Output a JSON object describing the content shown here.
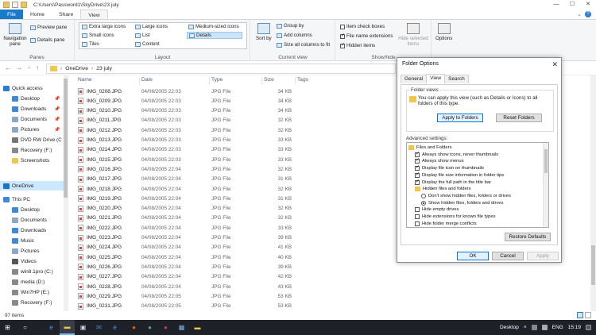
{
  "window": {
    "path": "C:\\Users\\Password1\\SkyDrive\\23 july",
    "controls": [
      "—",
      "☐",
      "✕"
    ]
  },
  "ribbon_tabs": [
    "File",
    "Home",
    "Share",
    "View"
  ],
  "ribbon": {
    "panes": {
      "navigation_pane": "Navigation pane",
      "preview_pane": "Preview pane",
      "details_pane": "Details pane",
      "label": "Panes"
    },
    "layout": {
      "items": [
        "Extra large icons",
        "Large icons",
        "Medium-sized icons",
        "Small icons",
        "List",
        "Details",
        "Tiles",
        "Content"
      ],
      "selected": "Details",
      "label": "Layout"
    },
    "current_view": {
      "sort_by": "Sort by",
      "group_by": "Group by",
      "add_columns": "Add columns",
      "size_all": "Size all columns to fit",
      "label": "Current view"
    },
    "show_hide": {
      "item_check_boxes": {
        "label": "Item check boxes",
        "checked": false
      },
      "file_name_extensions": {
        "label": "File name extensions",
        "checked": true
      },
      "hidden_items": {
        "label": "Hidden items",
        "checked": true
      },
      "hide_selected": "Hide selected items",
      "label": "Show/hide"
    },
    "options": "Options"
  },
  "address": {
    "crumbs": [
      "OneDrive",
      "23 july"
    ]
  },
  "nav_pane": {
    "items": [
      {
        "label": "Quick access",
        "icon": "star-icon",
        "color": "#2b7cd3",
        "indent": 0
      },
      {
        "label": "Desktop",
        "icon": "desktop-icon",
        "color": "#3b8ad9",
        "indent": 1,
        "pinned": true
      },
      {
        "label": "Downloads",
        "icon": "download-icon",
        "color": "#3b8ad9",
        "indent": 1,
        "pinned": true
      },
      {
        "label": "Documents",
        "icon": "documents-icon",
        "color": "#8ca6c8",
        "indent": 1,
        "pinned": true
      },
      {
        "label": "Pictures",
        "icon": "pictures-icon",
        "color": "#8ca6c8",
        "indent": 1,
        "pinned": true
      },
      {
        "label": "DVD RW Drive (C",
        "icon": "dvd-icon",
        "color": "#777777",
        "indent": 1
      },
      {
        "label": "Recovery (F:)",
        "icon": "drive-icon",
        "color": "#888888",
        "indent": 1
      },
      {
        "label": "Screenshots",
        "icon": "folder-icon",
        "color": "#f0c64b",
        "indent": 1
      },
      {
        "label": "OneDrive",
        "icon": "cloud-icon",
        "color": "#1f73c6",
        "indent": 0,
        "selected": true
      },
      {
        "label": "This PC",
        "icon": "pc-icon",
        "color": "#3b8ad9",
        "indent": 0
      },
      {
        "label": "Desktop",
        "icon": "desktop-icon",
        "color": "#3b8ad9",
        "indent": 1
      },
      {
        "label": "Documents",
        "icon": "documents-icon",
        "color": "#8ca6c8",
        "indent": 1
      },
      {
        "label": "Downloads",
        "icon": "download-icon",
        "color": "#3b8ad9",
        "indent": 1
      },
      {
        "label": "Music",
        "icon": "music-icon",
        "color": "#3b8ad9",
        "indent": 1
      },
      {
        "label": "Pictures",
        "icon": "pictures-icon",
        "color": "#8ca6c8",
        "indent": 1
      },
      {
        "label": "Videos",
        "icon": "video-icon",
        "color": "#555555",
        "indent": 1
      },
      {
        "label": "win8.1pro (C:)",
        "icon": "drive-icon",
        "color": "#888888",
        "indent": 1
      },
      {
        "label": "media (D:)",
        "icon": "drive-icon",
        "color": "#888888",
        "indent": 1
      },
      {
        "label": "Win7HP (E:)",
        "icon": "drive-icon",
        "color": "#888888",
        "indent": 1
      },
      {
        "label": "Recovery (F:)",
        "icon": "drive-icon",
        "color": "#888888",
        "indent": 1
      }
    ]
  },
  "columns": [
    "Name",
    "Date",
    "Type",
    "Size",
    "Tags"
  ],
  "files": [
    {
      "name": "IMG_0208.JPG",
      "date": "04/08/2005 22:03",
      "type": "JPG File",
      "size": "34 KB"
    },
    {
      "name": "IMG_0209.JPG",
      "date": "04/08/2005 22:03",
      "type": "JPG File",
      "size": "34 KB"
    },
    {
      "name": "IMG_0210.JPG",
      "date": "04/08/2005 22:03",
      "type": "JPG File",
      "size": "34 KB"
    },
    {
      "name": "IMG_0211.JPG",
      "date": "04/08/2005 22:03",
      "type": "JPG File",
      "size": "32 KB"
    },
    {
      "name": "IMG_0212.JPG",
      "date": "04/08/2005 22:03",
      "type": "JPG File",
      "size": "32 KB"
    },
    {
      "name": "IMG_0213.JPG",
      "date": "04/08/2005 22:03",
      "type": "JPG File",
      "size": "33 KB"
    },
    {
      "name": "IMG_0214.JPG",
      "date": "04/08/2005 22:03",
      "type": "JPG File",
      "size": "33 KB"
    },
    {
      "name": "IMG_0215.JPG",
      "date": "04/08/2005 22:03",
      "type": "JPG File",
      "size": "33 KB"
    },
    {
      "name": "IMG_0216.JPG",
      "date": "04/08/2005 22:04",
      "type": "JPG File",
      "size": "32 KB"
    },
    {
      "name": "IMG_0217.JPG",
      "date": "04/08/2005 22:04",
      "type": "JPG File",
      "size": "31 KB"
    },
    {
      "name": "IMG_0218.JPG",
      "date": "04/08/2005 22:04",
      "type": "JPG File",
      "size": "32 KB"
    },
    {
      "name": "IMG_0219.JPG",
      "date": "04/08/2005 22:04",
      "type": "JPG File",
      "size": "31 KB"
    },
    {
      "name": "IMG_0220.JPG",
      "date": "04/08/2005 22:04",
      "type": "JPG File",
      "size": "32 KB"
    },
    {
      "name": "IMG_0221.JPG",
      "date": "04/08/2005 22:04",
      "type": "JPG File",
      "size": "32 KB"
    },
    {
      "name": "IMG_0222.JPG",
      "date": "04/08/2005 22:04",
      "type": "JPG File",
      "size": "33 KB"
    },
    {
      "name": "IMG_0223.JPG",
      "date": "04/08/2005 22:04",
      "type": "JPG File",
      "size": "39 KB"
    },
    {
      "name": "IMG_0224.JPG",
      "date": "04/08/2005 22:04",
      "type": "JPG File",
      "size": "41 KB"
    },
    {
      "name": "IMG_0225.JPG",
      "date": "04/08/2005 22:04",
      "type": "JPG File",
      "size": "40 KB"
    },
    {
      "name": "IMG_0226.JPG",
      "date": "04/08/2005 22:04",
      "type": "JPG File",
      "size": "39 KB"
    },
    {
      "name": "IMG_0227.JPG",
      "date": "04/08/2005 22:04",
      "type": "JPG File",
      "size": "42 KB"
    },
    {
      "name": "IMG_0228.JPG",
      "date": "04/08/2005 22:04",
      "type": "JPG File",
      "size": "43 KB"
    },
    {
      "name": "IMG_0229.JPG",
      "date": "04/08/2005 22:05",
      "type": "JPG File",
      "size": "53 KB"
    },
    {
      "name": "IMG_0231.JPG",
      "date": "04/08/2005 22:05",
      "type": "JPG File",
      "size": "53 KB"
    },
    {
      "name": "standingIMG_0149.J...",
      "date": "04/08/2005 22:00",
      "type": "JPG File",
      "size": "33 KB"
    }
  ],
  "status": {
    "item_count": "97 items"
  },
  "taskbar": {
    "items": [
      {
        "name": "start-icon",
        "glyph": "⊞",
        "color": "#ffffff"
      },
      {
        "name": "search-icon",
        "glyph": "○",
        "color": "#ffffff"
      },
      {
        "name": "edge-icon",
        "glyph": "e",
        "color": "#3aa0ff"
      },
      {
        "name": "file-explorer-icon",
        "glyph": "▬",
        "color": "#f0c64b",
        "active": true
      },
      {
        "name": "store-icon",
        "glyph": "▣",
        "color": "#cfd8e3"
      },
      {
        "name": "mail-icon",
        "glyph": "✉",
        "color": "#3a8ee6"
      },
      {
        "name": "edge2-icon",
        "glyph": "e",
        "color": "#3aa0ff"
      },
      {
        "name": "firefox-icon",
        "glyph": "●",
        "color": "#e66000"
      },
      {
        "name": "chrome-icon",
        "glyph": "●",
        "color": "#4caf50"
      },
      {
        "name": "media-icon",
        "glyph": "●",
        "color": "#d23c3c"
      },
      {
        "name": "paint-icon",
        "glyph": "▦",
        "color": "#7fb2e5"
      },
      {
        "name": "explorer-window-icon",
        "glyph": "▬",
        "color": "#f0c64b"
      }
    ],
    "desktop": "Desktop",
    "lang": "ENG",
    "time": "15:19"
  },
  "dialog": {
    "title": "Folder Options",
    "tabs": [
      "General",
      "View",
      "Search"
    ],
    "active_tab": "View",
    "folder_views": {
      "legend": "Folder views",
      "text": "You can apply this view (such as Details or Icons) to all folders of this type.",
      "apply": "Apply to Folders",
      "reset": "Reset Folders"
    },
    "advanced_label": "Advanced settings:",
    "advanced": [
      {
        "kind": "folder",
        "label": "Files and Folders",
        "indent": 0
      },
      {
        "kind": "check",
        "label": "Always show icons, never thumbnails",
        "checked": true,
        "indent": 1
      },
      {
        "kind": "check",
        "label": "Always show menus",
        "checked": true,
        "indent": 1
      },
      {
        "kind": "check",
        "label": "Display file icon on thumbnails",
        "checked": true,
        "indent": 1
      },
      {
        "kind": "check",
        "label": "Display file size information in folder tips",
        "checked": true,
        "indent": 1
      },
      {
        "kind": "check",
        "label": "Display the full path in the title bar",
        "checked": true,
        "indent": 1
      },
      {
        "kind": "folder",
        "label": "Hidden files and folders",
        "indent": 1
      },
      {
        "kind": "radio",
        "label": "Don't show hidden files, folders or drives",
        "checked": false,
        "indent": 2
      },
      {
        "kind": "radio",
        "label": "Show hidden files, folders and drives",
        "checked": true,
        "indent": 2
      },
      {
        "kind": "check",
        "label": "Hide empty drives",
        "checked": false,
        "indent": 1
      },
      {
        "kind": "check",
        "label": "Hide extensions for known file types",
        "checked": false,
        "indent": 1
      },
      {
        "kind": "check",
        "label": "Hide folder merge conflicts",
        "checked": false,
        "indent": 1
      }
    ],
    "restore": "Restore Defaults",
    "ok": "OK",
    "cancel": "Cancel",
    "apply": "Apply"
  }
}
